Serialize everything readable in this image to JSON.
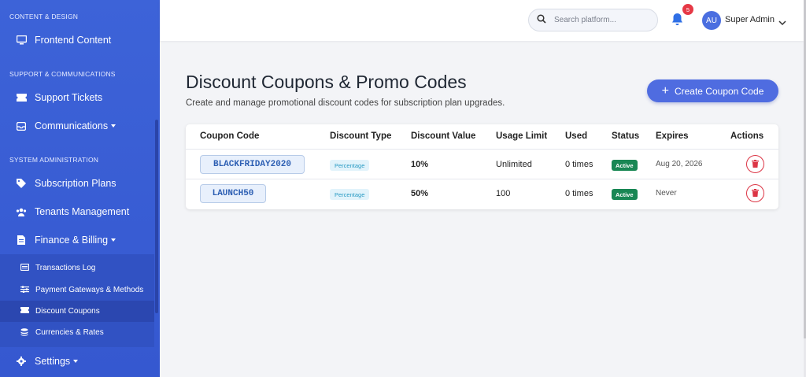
{
  "sidebar": {
    "sections": {
      "content_design": "CONTENT & DESIGN",
      "support": "SUPPORT & COMMUNICATIONS",
      "system": "SYSTEM ADMINISTRATION"
    },
    "items": {
      "frontend_content": "Frontend Content",
      "support_tickets": "Support Tickets",
      "communications": "Communications",
      "subscription_plans": "Subscription Plans",
      "tenants_management": "Tenants Management",
      "finance_billing": "Finance & Billing",
      "settings": "Settings"
    },
    "finance_sub": {
      "transactions_log": "Transactions Log",
      "payment_gateways": "Payment Gateways & Methods",
      "discount_coupons": "Discount Coupons",
      "currencies_rates": "Currencies & Rates"
    }
  },
  "topbar": {
    "search_placeholder": "Search platform...",
    "notification_count": "5",
    "avatar_initials": "AU",
    "user_name": "Super Admin"
  },
  "main": {
    "title": "Discount Coupons & Promo Codes",
    "subtitle": "Create and manage promotional discount codes for subscription plan upgrades.",
    "create_button": "Create Coupon Code",
    "table": {
      "headers": {
        "code": "Coupon Code",
        "type": "Discount Type",
        "value": "Discount Value",
        "limit": "Usage Limit",
        "used": "Used",
        "status": "Status",
        "expires": "Expires",
        "actions": "Actions"
      },
      "rows": [
        {
          "code": "BLACKFRIDAY2020",
          "type": "Percentage",
          "value": "10%",
          "limit": "Unlimited",
          "used": "0 times",
          "status": "Active",
          "expires": "Aug 20, 2026"
        },
        {
          "code": "LAUNCH50",
          "type": "Percentage",
          "value": "50%",
          "limit": "100",
          "used": "0 times",
          "status": "Active",
          "expires": "Never"
        }
      ]
    }
  },
  "colors": {
    "sidebar": "#3d63d8",
    "accent": "#4f6ce0",
    "active_status": "#198754",
    "danger": "#dc3545"
  }
}
